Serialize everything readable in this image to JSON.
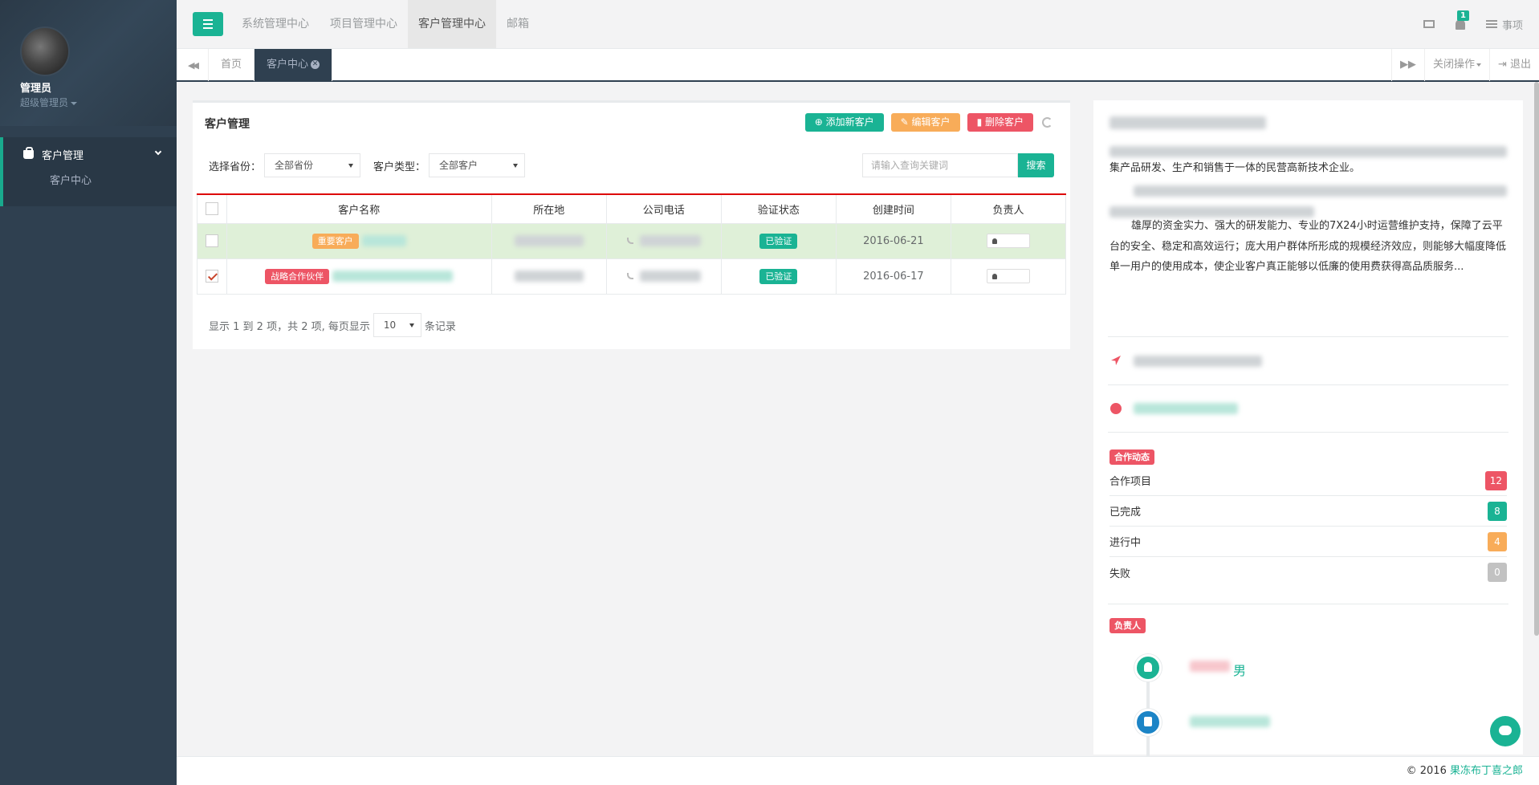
{
  "sidebar": {
    "profile_name": "管理员",
    "profile_role": "超级管理员",
    "menu_label": "客户管理",
    "submenu_label": "客户中心"
  },
  "topnav": {
    "items": [
      "系统管理中心",
      "项目管理中心",
      "客户管理中心",
      "邮箱"
    ],
    "active_index": 2,
    "notifications_count": "1",
    "tasks_label": "事项"
  },
  "tabs": {
    "home": "首页",
    "active": "客户中心",
    "close_ops": "关闭操作",
    "logout": "退出"
  },
  "panel": {
    "title": "客户管理",
    "add_button": "添加新客户",
    "edit_button": "编辑客户",
    "delete_button": "删除客户",
    "province_label": "选择省份：",
    "province_value": "全部省份",
    "type_label": "客户类型：",
    "type_value": "全部客户",
    "search_placeholder": "请输入查询关键词",
    "search_button": "搜索",
    "columns": [
      "客户名称",
      "所在地",
      "公司电话",
      "验证状态",
      "创建时间",
      "负责人"
    ],
    "rows": [
      {
        "tag": "重要客户",
        "status": "已验证",
        "date": "2016-06-21",
        "checked": false
      },
      {
        "tag": "战略合作伙伴",
        "status": "已验证",
        "date": "2016-06-17",
        "checked": true
      }
    ],
    "pager_prefix": "显示 1 到 2 项，共 2 项, 每页显示",
    "pager_size": "10",
    "pager_suffix": "条记录"
  },
  "detail": {
    "desc_line1": "集产品研发、生产和销售于一体的民营高新技术企业。",
    "desc_para": "雄厚的资金实力、强大的研发能力、专业的7X24小时运营维护支持，保障了云平台的安全、稳定和高效运行；庞大用户群体所形成的规模经济效应，则能够大幅度降低单一用户的使用成本，使企业客户真正能够以低廉的使用费获得高品质服务...",
    "coop_label": "合作动态",
    "stats": [
      {
        "label": "合作项目",
        "value": "12",
        "color": "#ed5565"
      },
      {
        "label": "已完成",
        "value": "8",
        "color": "#1ab394"
      },
      {
        "label": "进行中",
        "value": "4",
        "color": "#f8ac59"
      },
      {
        "label": "失败",
        "value": "0",
        "color": "#c2c2c2"
      }
    ],
    "owner_label": "负责人",
    "owner_gender": "男"
  },
  "footer": {
    "copyright": "© 2016",
    "brand": "果冻布丁喜之郎"
  }
}
